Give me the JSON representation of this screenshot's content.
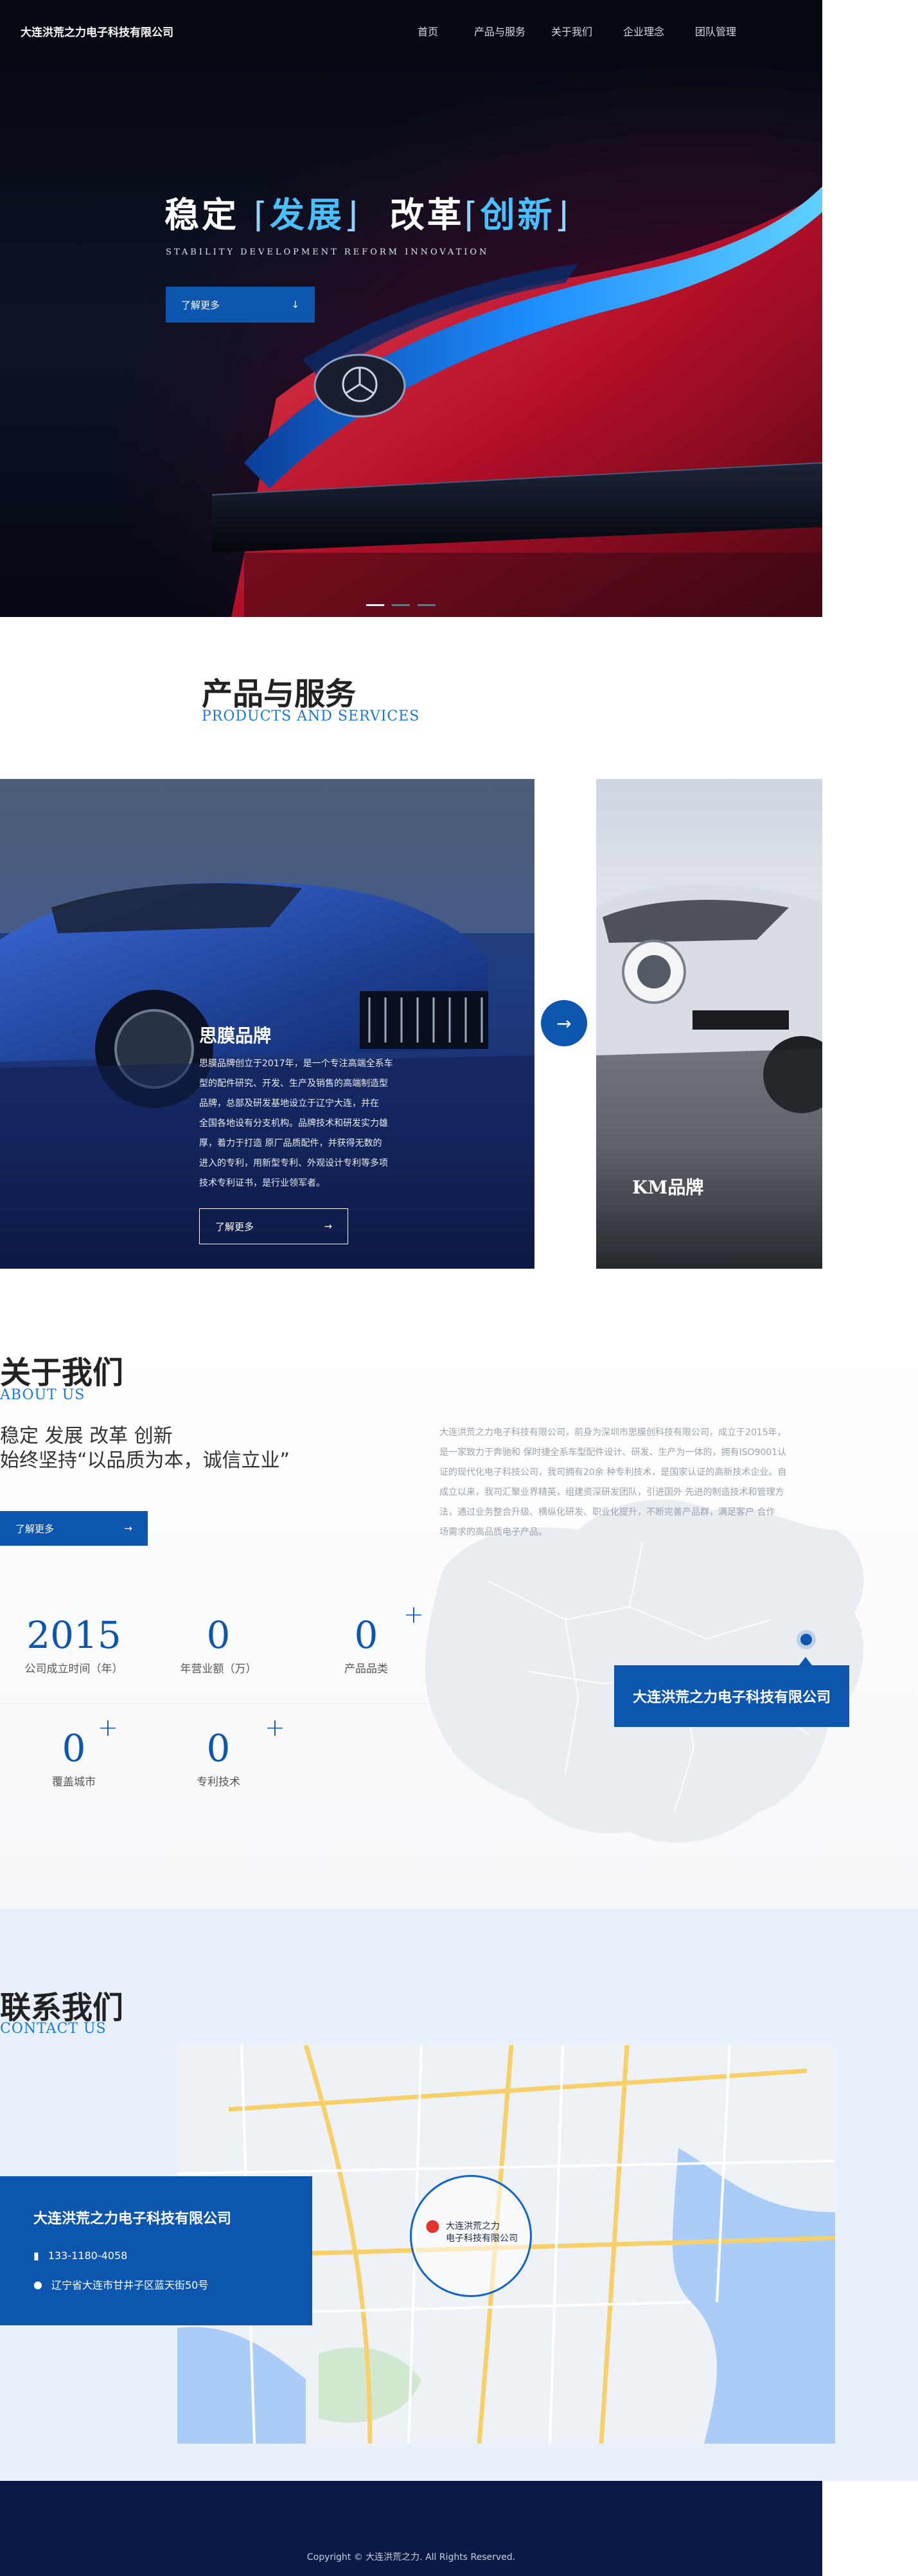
{
  "header": {
    "logo": "大连洪荒之力电子科技有限公司",
    "nav": [
      "首页",
      "产品与服务",
      "关于我们",
      "企业理念",
      "团队管理"
    ]
  },
  "hero": {
    "title_part1": "稳定",
    "title_part2": "发展",
    "title_part3": "改革",
    "title_part4": "创新",
    "tagline": "STABILITY   DEVELOPMENT   REFORM   INNOVATION",
    "button": "了解更多"
  },
  "products": {
    "title": "产品与服务",
    "subtitle": "PRODUCTS AND SERVICES",
    "card1": {
      "title": "思膜品牌",
      "text_lines": [
        "思膜品牌创立于2017年，是一个专注高端全系车",
        "型的配件研究、开发、生产及销售的高端制造型",
        "品牌，总部及研发基地设立于辽宁大连，并在",
        "全国各地设有分支机构。品牌技术和研发实力雄",
        "厚，着力于打造 原厂品质配件，并获得无数的",
        "进入的专利，用新型专利、外观设计专利等多项",
        "技术专利证书，是行业领军者。"
      ],
      "button": "了解更多"
    },
    "card2": {
      "title": "KM品牌"
    }
  },
  "about": {
    "title": "关于我们",
    "subtitle": "ABOUT US",
    "slogan_line1": "稳定 发展 改革 创新",
    "slogan_line2": "始终坚持“以品质为本，诚信立业”",
    "button": "了解更多",
    "desc_lines": [
      "大连洪荒之力电子科技有限公司，前身为深圳市思膜创科技有限公司，成立于2015年，",
      "是一家致力于奔驰和 保时捷全系车型配件设计、研发、生产为一体的，拥有ISO9001认",
      "证的现代化电子科技公司，我司拥有20余 种专利技术，是国家认证的高新技术企业。自",
      "成立以来，我司汇聚业界精英，组建资深研发团队，引进国外 先进的制造技术和管理方",
      "法，通过业务整合升级、横纵化研发、职业化提升，不断完善产品群，满足客户 合作",
      "场需求的高品质电子产品。"
    ],
    "stats": [
      {
        "num": "2015",
        "label": "公司成立时间（年）"
      },
      {
        "num": "0",
        "label": "年营业额（万）"
      },
      {
        "num": "0",
        "label": "产品品类"
      },
      {
        "num": "0",
        "label": "覆盖城市"
      },
      {
        "num": "0",
        "label": "专利技术"
      }
    ],
    "plus": "+",
    "map_label": "大连洪荒之力电子科技有限公司"
  },
  "contact": {
    "title": "联系我们",
    "subtitle": "CONTACT US",
    "company": "大连洪荒之力电子科技有限公司",
    "phone": "133-1180-4058",
    "address": "辽宁省大连市甘井子区蓝天街50号",
    "pin_line1": "大连洪荒之力",
    "pin_line2": "电子科技有限公司"
  },
  "footer": {
    "copyright": "Copyright © 大连洪荒之力. All Rights Reserved."
  },
  "colors": {
    "brand": "#0c56b0",
    "accent": "#1877d8",
    "footer": "#0a1a44"
  }
}
